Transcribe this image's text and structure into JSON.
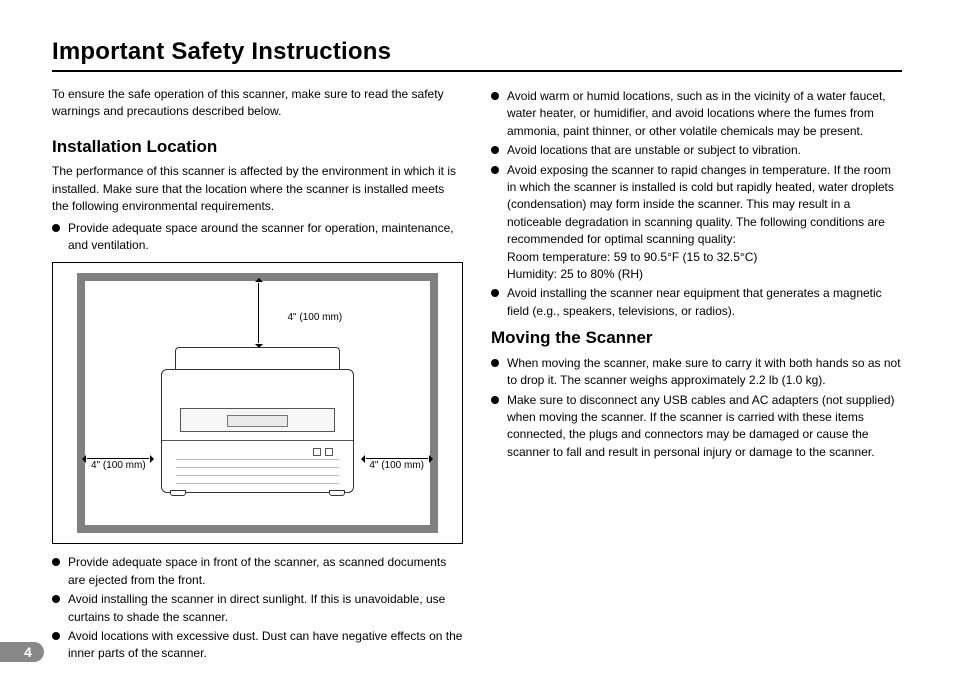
{
  "page_number": "4",
  "title": "Important Safety Instructions",
  "intro": "To ensure the safe operation of this scanner, make sure to read the safety warnings and precautions described below.",
  "sections": {
    "installation": {
      "heading": "Installation Location",
      "lead": "The performance of this scanner is affected by the environment in which it is installed. Make sure that the location where the scanner is installed meets the following environmental requirements.",
      "bullets_pre": [
        "Provide adequate space around the scanner for operation, maintenance, and ventilation."
      ],
      "diagram": {
        "clearance_top": "4\" (100 mm)",
        "clearance_left": "4\" (100 mm)",
        "clearance_right": "4\" (100 mm)"
      },
      "bullets_post": [
        "Provide adequate space in front of the scanner, as scanned documents are ejected from the front.",
        "Avoid installing the scanner in direct sunlight. If this is unavoidable, use curtains to shade the scanner.",
        "Avoid locations with excessive dust. Dust can have negative effects on the inner parts of the scanner."
      ],
      "bullets_col2": [
        "Avoid warm or humid locations, such as in the vicinity of a water faucet, water heater, or humidifier, and avoid locations where the fumes from ammonia, paint thinner, or other volatile chemicals may be present.",
        "Avoid locations that are unstable or subject to vibration.",
        "Avoid exposing the scanner to rapid changes in temperature. If the room in which the scanner is installed is cold but rapidly heated, water droplets (condensation) may form inside the scanner. This may result in a noticeable degradation in scanning quality. The following conditions are recommended for optimal scanning quality:",
        "Avoid installing the scanner near equipment that generates a magnetic field (e.g., speakers, televisions, or radios)."
      ],
      "conditions": {
        "temp": "Room temperature: 59 to 90.5°F (15 to 32.5°C)",
        "humidity": "Humidity: 25 to 80% (RH)"
      }
    },
    "moving": {
      "heading": "Moving the Scanner",
      "bullets": [
        "When moving the scanner, make sure to carry it with both hands so as not to drop it. The scanner weighs approximately 2.2 lb (1.0 kg).",
        "Make sure to disconnect any USB cables and AC adapters (not supplied) when moving the scanner. If the scanner is carried with these items connected, the plugs and connectors may be damaged or cause the scanner to fall and result in personal injury or damage to the scanner."
      ]
    }
  }
}
